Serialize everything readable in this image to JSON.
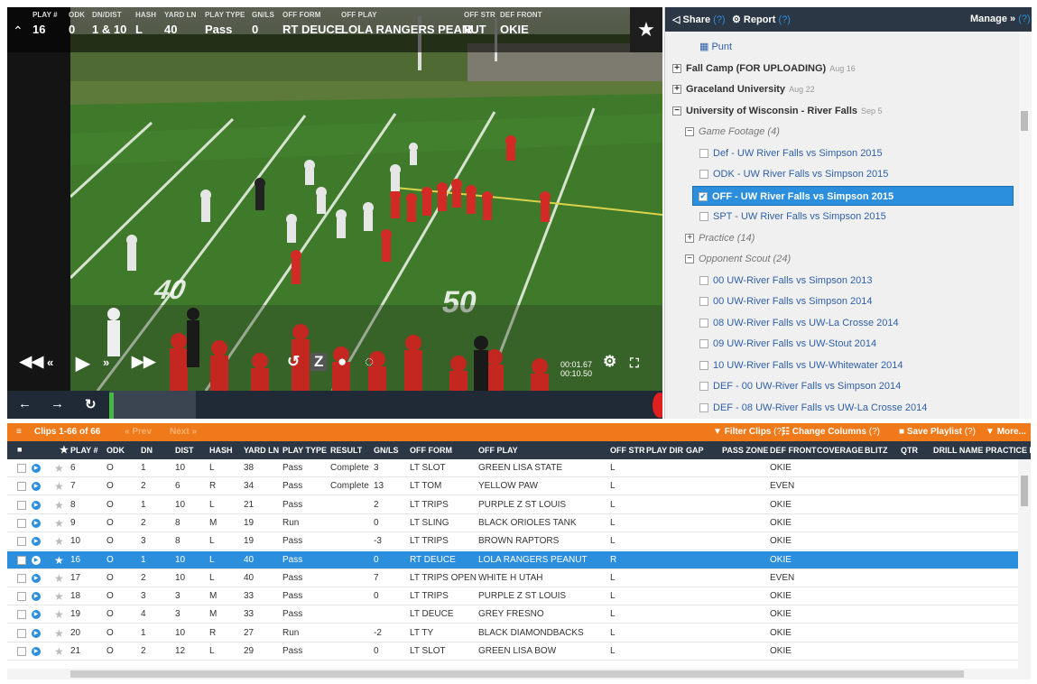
{
  "hud": {
    "columns": [
      {
        "label": "PLAY #",
        "value": "16"
      },
      {
        "label": "ODK",
        "value": "0"
      },
      {
        "label": "DN/DIST",
        "value": "1 & 10"
      },
      {
        "label": "HASH",
        "value": "L"
      },
      {
        "label": "YARD LN",
        "value": "40"
      },
      {
        "label": "PLAY TYPE",
        "value": "Pass"
      },
      {
        "label": "GN/LS",
        "value": "0"
      },
      {
        "label": "OFF FORM",
        "value": "RT DEUCE"
      },
      {
        "label": "OFF PLAY",
        "value": "LOLA RANGERS PEANUT"
      },
      {
        "label": "OFF STR",
        "value": "R"
      },
      {
        "label": "DEF FRONT",
        "value": "OKIE"
      }
    ]
  },
  "player": {
    "time_current": "00:01.67",
    "time_total": "00:10.50",
    "yard_markers": [
      "40",
      "50"
    ]
  },
  "panel": {
    "share_label": "Share",
    "share_help": "(?)",
    "report_label": "Report",
    "report_help": "(?)",
    "manage_label": "Manage »",
    "manage_help": "(?)",
    "tree": [
      {
        "type": "film",
        "indent": 38,
        "label": "Punt",
        "checkbox": false,
        "icon": true
      },
      {
        "type": "game",
        "indent": 8,
        "label": "Fall Camp (FOR UPLOADING)",
        "date": "Aug 16",
        "toggle": "+"
      },
      {
        "type": "game",
        "indent": 8,
        "label": "Graceland University",
        "date": "Aug 22",
        "toggle": "+"
      },
      {
        "type": "game",
        "indent": 8,
        "label": "University of Wisconsin - River Falls",
        "date": "Sep 5",
        "toggle": "−"
      },
      {
        "type": "folder",
        "indent": 22,
        "label": "Game Footage (4)",
        "toggle": "−"
      },
      {
        "type": "film",
        "indent": 38,
        "label": "Def - UW River Falls vs Simpson 2015",
        "checkbox": true
      },
      {
        "type": "film",
        "indent": 38,
        "label": "ODK - UW River Falls vs Simpson 2015",
        "checkbox": true
      },
      {
        "type": "film",
        "indent": 38,
        "label": "OFF - UW River Falls vs Simpson 2015",
        "checkbox": true,
        "selected": true
      },
      {
        "type": "film",
        "indent": 38,
        "label": "SPT - UW River Falls vs Simpson 2015",
        "checkbox": true
      },
      {
        "type": "folder",
        "indent": 22,
        "label": "Practice (14)",
        "toggle": "+"
      },
      {
        "type": "folder",
        "indent": 22,
        "label": "Opponent Scout (24)",
        "toggle": "−"
      },
      {
        "type": "film",
        "indent": 38,
        "label": "00 UW-River Falls vs Simpson 2013",
        "checkbox": true
      },
      {
        "type": "film",
        "indent": 38,
        "label": "00 UW-River Falls vs Simpson 2014",
        "checkbox": true
      },
      {
        "type": "film",
        "indent": 38,
        "label": "08 UW-River Falls vs UW-La Crosse 2014",
        "checkbox": true
      },
      {
        "type": "film",
        "indent": 38,
        "label": "09 UW-River Falls vs UW-Stout 2014",
        "checkbox": true
      },
      {
        "type": "film",
        "indent": 38,
        "label": "10 UW-River Falls vs UW-Whitewater 2014",
        "checkbox": true
      },
      {
        "type": "film",
        "indent": 38,
        "label": "DEF - 00 UW-River Falls vs Simpson 2014",
        "checkbox": true
      },
      {
        "type": "film",
        "indent": 38,
        "label": "DEF - 08 UW-River Falls vs UW-La Crosse 2014",
        "checkbox": true
      }
    ]
  },
  "clipsbar": {
    "clips_label": "Clips 1-66 of 66",
    "prev_label": "« Prev",
    "next_label": "Next »",
    "filter_label": "Filter Clips",
    "filter_help": "(?)",
    "columns_label": "Change Columns",
    "columns_help": "(?)",
    "playlist_label": "Save Playlist",
    "playlist_help": "(?)",
    "more_label": "More..."
  },
  "grid": {
    "headers": [
      "PLAY #",
      "ODK",
      "DN",
      "DIST",
      "HASH",
      "YARD LN",
      "PLAY TYPE",
      "RESULT",
      "GN/LS",
      "OFF FORM",
      "OFF PLAY",
      "OFF STR",
      "PLAY DIR",
      "GAP",
      "PASS ZONE",
      "DEF FRONT",
      "COVERAGE",
      "BLITZ",
      "QTR",
      "DRILL NAME",
      "PRACTICE P"
    ],
    "rows": [
      {
        "play": "6",
        "odk": "O",
        "dn": "1",
        "dist": "10",
        "hash": "L",
        "yard": "38",
        "type": "Pass",
        "result": "Complete",
        "gnls": "3",
        "form": "LT SLOT",
        "play_name": "GREEN LISA STATE",
        "str": "L",
        "front": "OKIE"
      },
      {
        "play": "7",
        "odk": "O",
        "dn": "2",
        "dist": "6",
        "hash": "R",
        "yard": "34",
        "type": "Pass",
        "result": "Complete",
        "gnls": "13",
        "form": "LT TOM",
        "play_name": "YELLOW PAW",
        "str": "L",
        "front": "EVEN"
      },
      {
        "play": "8",
        "odk": "O",
        "dn": "1",
        "dist": "10",
        "hash": "L",
        "yard": "21",
        "type": "Pass",
        "result": "",
        "gnls": "2",
        "form": "LT TRIPS",
        "play_name": "PURPLE Z ST LOUIS",
        "str": "L",
        "front": "OKIE"
      },
      {
        "play": "9",
        "odk": "O",
        "dn": "2",
        "dist": "8",
        "hash": "M",
        "yard": "19",
        "type": "Run",
        "result": "",
        "gnls": "0",
        "form": "LT SLING",
        "play_name": "BLACK ORIOLES TANK",
        "str": "L",
        "front": "OKIE"
      },
      {
        "play": "10",
        "odk": "O",
        "dn": "3",
        "dist": "8",
        "hash": "L",
        "yard": "19",
        "type": "Pass",
        "result": "",
        "gnls": "-3",
        "form": "LT TRIPS",
        "play_name": "BROWN RAPTORS",
        "str": "L",
        "front": "OKIE"
      },
      {
        "play": "16",
        "odk": "O",
        "dn": "1",
        "dist": "10",
        "hash": "L",
        "yard": "40",
        "type": "Pass",
        "result": "",
        "gnls": "0",
        "form": "RT DEUCE",
        "play_name": "LOLA RANGERS PEANUT",
        "str": "R",
        "front": "OKIE",
        "selected": true
      },
      {
        "play": "17",
        "odk": "O",
        "dn": "2",
        "dist": "10",
        "hash": "L",
        "yard": "40",
        "type": "Pass",
        "result": "",
        "gnls": "7",
        "form": "LT TRIPS OPEN",
        "play_name": "WHITE H UTAH",
        "str": "L",
        "front": "EVEN"
      },
      {
        "play": "18",
        "odk": "O",
        "dn": "3",
        "dist": "3",
        "hash": "M",
        "yard": "33",
        "type": "Pass",
        "result": "",
        "gnls": "0",
        "form": "LT TRIPS",
        "play_name": "PURPLE Z ST LOUIS",
        "str": "L",
        "front": "OKIE"
      },
      {
        "play": "19",
        "odk": "O",
        "dn": "4",
        "dist": "3",
        "hash": "M",
        "yard": "33",
        "type": "Pass",
        "result": "",
        "gnls": "",
        "form": "LT DEUCE",
        "play_name": "GREY FRESNO",
        "str": "L",
        "front": "OKIE"
      },
      {
        "play": "20",
        "odk": "O",
        "dn": "1",
        "dist": "10",
        "hash": "R",
        "yard": "27",
        "type": "Run",
        "result": "",
        "gnls": "-2",
        "form": "LT TY",
        "play_name": "BLACK DIAMONDBACKS",
        "str": "L",
        "front": "OKIE"
      },
      {
        "play": "21",
        "odk": "O",
        "dn": "2",
        "dist": "12",
        "hash": "L",
        "yard": "29",
        "type": "Pass",
        "result": "",
        "gnls": "0",
        "form": "LT SLOT",
        "play_name": "GREEN LISA BOW",
        "str": "L",
        "front": "OKIE"
      }
    ]
  }
}
